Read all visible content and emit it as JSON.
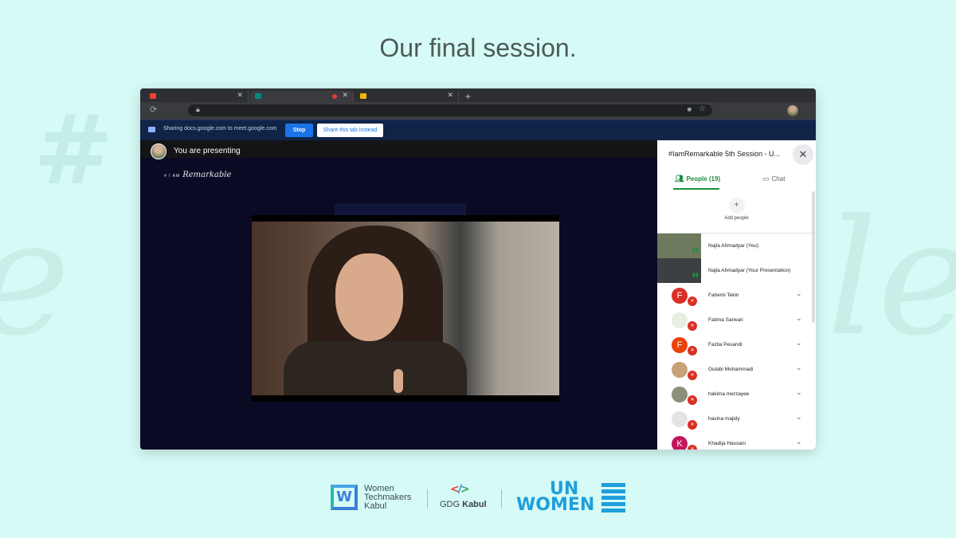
{
  "page": {
    "title": "Our final session."
  },
  "browser": {
    "share_message": "Sharing docs.google.com to meet.google.com",
    "stop_label": "Stop",
    "share_tab_label": "Share this tab instead",
    "new_tab_symbol": "+"
  },
  "meet": {
    "presenting_text": "You are presenting",
    "slide_logo_prefix": "# I AM",
    "slide_logo_script": "Remarkable",
    "panel_title": "#IamRemarkable 5th Session - U...",
    "people_tab": "People (19)",
    "chat_tab": "Chat",
    "add_people_label": "Add people",
    "participants": [
      {
        "name": "Najla Ahmadyar (You)",
        "avatar": "",
        "color": "#6d7a5e",
        "kind": "video"
      },
      {
        "name": "Najla Ahmadyar (Your Presentation)",
        "avatar": "",
        "color": "#3c4043",
        "kind": "presentation"
      },
      {
        "name": "Fahemi Tekin",
        "avatar": "F",
        "color": "#d93025",
        "kind": "letter"
      },
      {
        "name": "Fatima Sarwari",
        "avatar": "",
        "color": "#e6efe0",
        "kind": "photo"
      },
      {
        "name": "Fazila Pesandi",
        "avatar": "F",
        "color": "#e8430a",
        "kind": "letter"
      },
      {
        "name": "Gulabi Mohammadi",
        "avatar": "",
        "color": "#c9a178",
        "kind": "photo"
      },
      {
        "name": "hakima merzayee",
        "avatar": "",
        "color": "#8d8f7a",
        "kind": "photo"
      },
      {
        "name": "hasina majidy",
        "avatar": "",
        "color": "#e4e4e4",
        "kind": "photo"
      },
      {
        "name": "Khadija Hassani",
        "avatar": "K",
        "color": "#c2185b",
        "kind": "letter"
      }
    ]
  },
  "footer": {
    "wtm_line1": "Women",
    "wtm_line2": "Techmakers",
    "wtm_line3": "Kabul",
    "gdg_prefix": "GDG",
    "gdg_city": "Kabul",
    "un_line1": "UN",
    "un_line2": "WOMEN"
  },
  "colors": {
    "background": "#d6fbf6",
    "meet_green": "#1e8e3e",
    "stop_blue": "#1a73e8",
    "un_blue": "#1f9fdc"
  }
}
